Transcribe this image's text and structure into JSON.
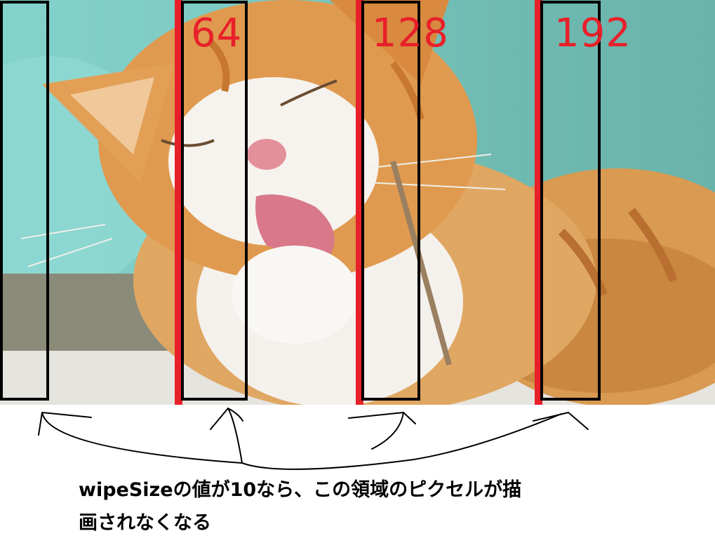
{
  "colors": {
    "marker_red": "#e8202a",
    "box_black": "#000000",
    "caption_text": "#000000"
  },
  "labels": [
    {
      "text": "64"
    },
    {
      "text": "128"
    },
    {
      "text": "192"
    }
  ],
  "caption": {
    "line1": "wipeSizeの値が10なら、この領域のピクセルが描",
    "line2": "画されなくなる"
  }
}
